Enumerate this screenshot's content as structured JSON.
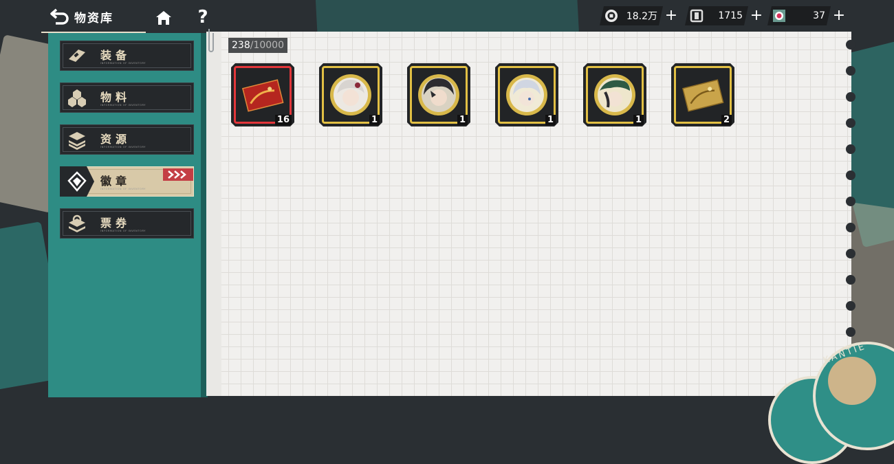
{
  "header": {
    "title": "物资库",
    "help_label": "?"
  },
  "resources": [
    {
      "name": "coin",
      "icon": "coin-icon",
      "value": "18.2万",
      "plus": "+"
    },
    {
      "name": "currency",
      "icon": "square-gem-icon",
      "value": "1715",
      "plus": "+"
    },
    {
      "name": "stamina",
      "icon": "target-ticket-icon",
      "value": "37",
      "plus": "+"
    }
  ],
  "sidebar": {
    "items": [
      {
        "label": "装备",
        "sub": "INFORMATION OF INVENTORY",
        "icon": "equipment-icon",
        "active": false
      },
      {
        "label": "物料",
        "sub": "INFORMATION OF INVENTORY",
        "icon": "materials-icon",
        "active": false
      },
      {
        "label": "资源",
        "sub": "INFORMATION OF INVENTORY",
        "icon": "resources-icon",
        "active": false
      },
      {
        "label": "徽章",
        "sub": "INFORMATION OF INVENTORY",
        "icon": "badge-icon",
        "active": true
      },
      {
        "label": "票券",
        "sub": "INFORMATION OF INVENTORY",
        "icon": "tickets-icon",
        "active": false
      }
    ]
  },
  "inventory": {
    "count": "238",
    "capacity": "/10000",
    "items": [
      {
        "name": "red-envelope-card",
        "rarity": "red",
        "qty": "16"
      },
      {
        "name": "badge-white-hair-girl",
        "rarity": "gold",
        "qty": "1"
      },
      {
        "name": "badge-dark-hair-boy",
        "rarity": "gold",
        "qty": "1"
      },
      {
        "name": "badge-silver-hair-girl",
        "rarity": "gold",
        "qty": "1"
      },
      {
        "name": "badge-green-hat-girl",
        "rarity": "gold",
        "qty": "1"
      },
      {
        "name": "gold-envelope-card",
        "rarity": "gold",
        "qty": "2"
      }
    ]
  },
  "emblem": {
    "text": "KANTIE"
  },
  "colors": {
    "teal": "#2e8c84",
    "dark": "#25282b",
    "gold": "#e2c044",
    "red": "#e2363a",
    "active_tab": "#d8c9a8"
  }
}
